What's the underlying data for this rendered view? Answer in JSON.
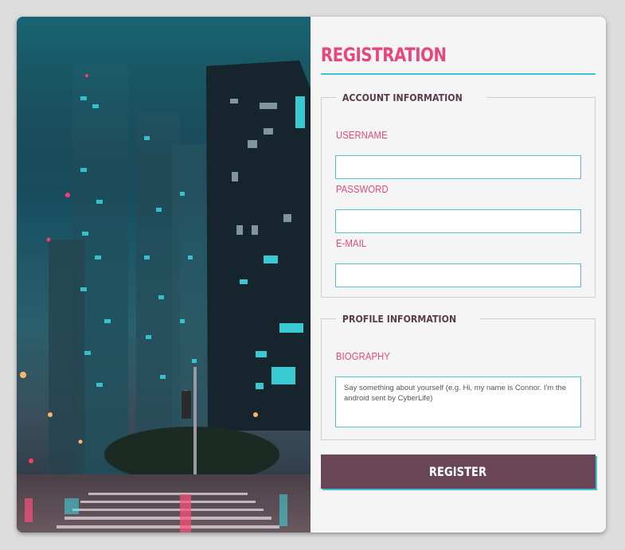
{
  "form": {
    "title": "REGISTRATION",
    "account_section": {
      "legend": "ACCOUNT INFORMATION",
      "username_label": "USERNAME",
      "username_value": "",
      "password_label": "PASSWORD",
      "password_value": "",
      "email_label": "E-MAIL",
      "email_value": ""
    },
    "profile_section": {
      "legend": "PROFILE INFORMATION",
      "biography_label": "BIOGRAPHY",
      "biography_placeholder": "Say something about yourself (e.g. Hi, my name is Connor. I'm the android sent by CyberLife)"
    },
    "register_label": "REGISTER"
  },
  "colors": {
    "accent_pink": "#e8467c",
    "accent_cyan": "#3bc4d6",
    "button_bg": "#6a4555",
    "legend_text": "#5a3d4c",
    "page_bg": "#dcdcdc",
    "panel_bg": "#f5f5f5"
  },
  "hero_image": {
    "subject": "night-city-skyscrapers-neon-crosswalk"
  }
}
